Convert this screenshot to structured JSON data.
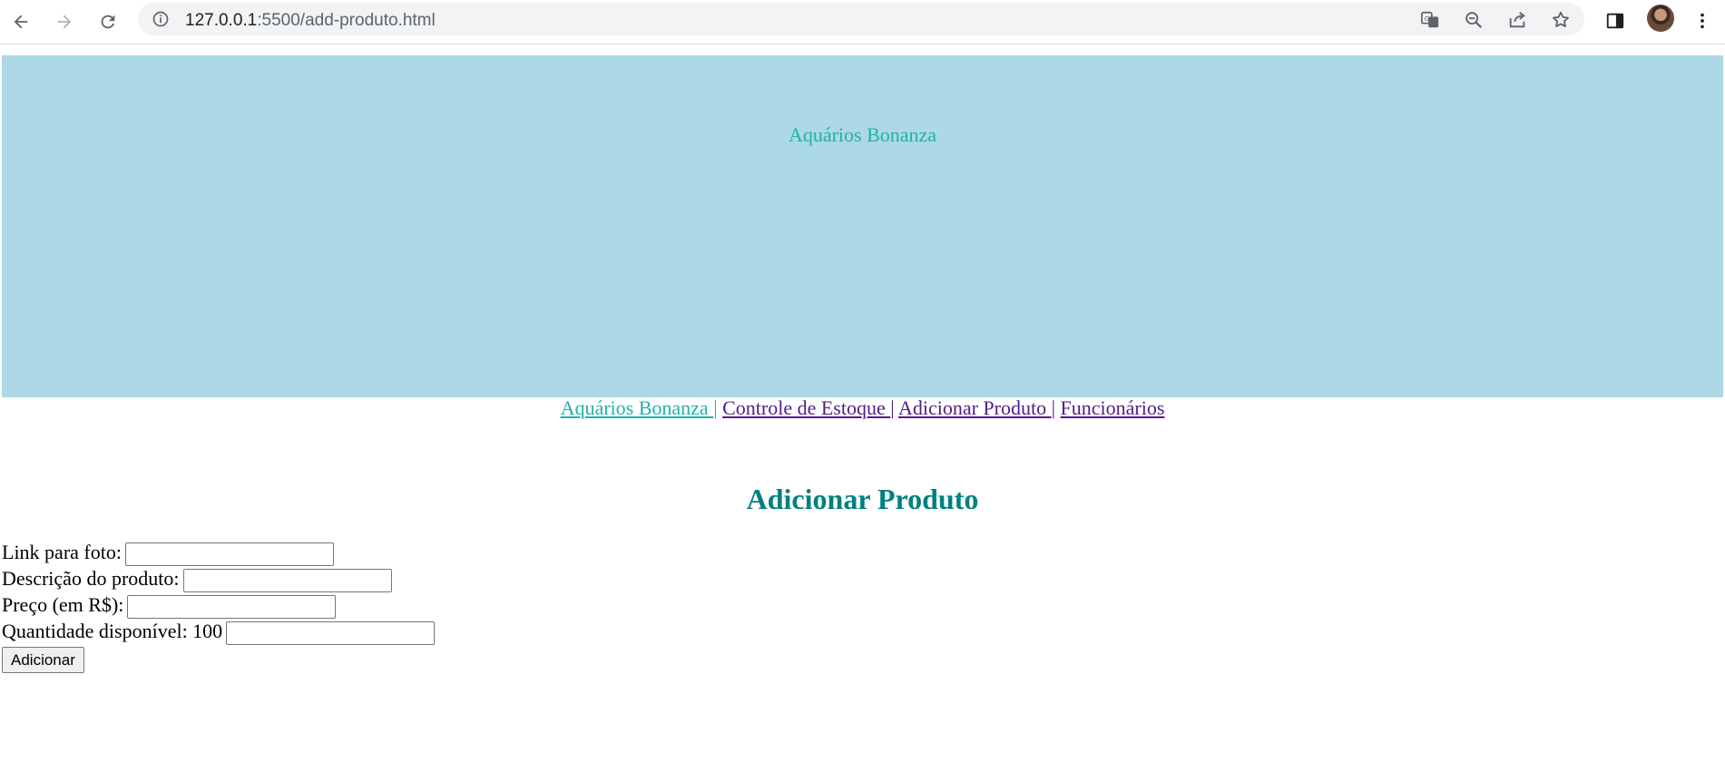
{
  "browser": {
    "url_host": "127.0.0.1",
    "url_path": ":5500/add-produto.html"
  },
  "banner": {
    "title": "Aquários Bonanza"
  },
  "menu": {
    "separator": "|",
    "items": [
      {
        "label": "Aquários Bonanza "
      },
      {
        "label": "Controle de Estoque "
      },
      {
        "label": "Adicionar Produto "
      },
      {
        "label": "Funcionários"
      }
    ]
  },
  "page": {
    "title": "Adicionar Produto"
  },
  "form": {
    "photo_label": "Link para foto:",
    "photo_value": "",
    "description_label": "Descrição do produto:",
    "description_value": "",
    "price_label": "Preço (em R$):",
    "price_value": "",
    "quantity_label": "Quantidade disponível: 100",
    "quantity_value": "",
    "submit_label": "Adicionar"
  },
  "colors": {
    "banner_bg": "#add8e6",
    "accent": "#20b2aa",
    "heading": "#008080",
    "visited_link": "#551a8b"
  }
}
